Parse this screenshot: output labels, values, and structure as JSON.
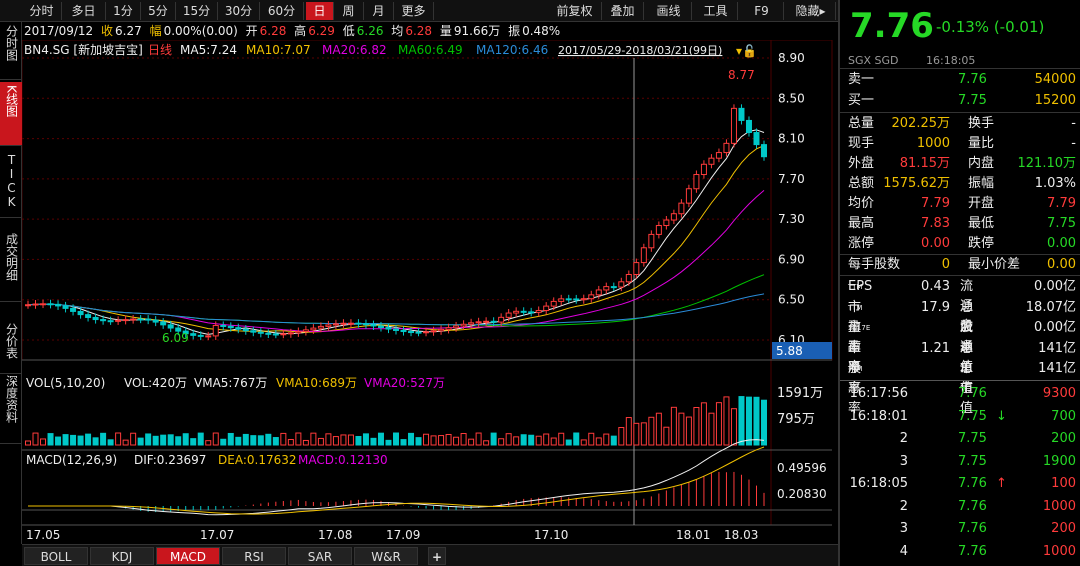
{
  "toolbar": {
    "left_buttons": [
      "分时",
      "多日",
      "1分",
      "5分",
      "15分",
      "30分",
      "60分",
      "日",
      "周",
      "月",
      "更多"
    ],
    "active": "日",
    "right_buttons": [
      "前复权",
      "叠加",
      "画线",
      "工具",
      "F9",
      "隐藏▸"
    ]
  },
  "left_tabs": [
    "分时图",
    "K线图",
    "TICK",
    "成交明细",
    "分价表",
    "深度资料"
  ],
  "left_active": "K线图",
  "ohlc_bar": {
    "date": "2017/09/12",
    "close_label": "收",
    "close": "6.27",
    "change_label": "幅",
    "change": "0.00%(0.00)",
    "open_label": "开",
    "open": "6.28",
    "high_label": "高",
    "high": "6.29",
    "low_label": "低",
    "low": "6.26",
    "avg_label": "均",
    "avg": "6.28",
    "vol_label": "量",
    "vol": "91.66万",
    "amp_label": "振",
    "amp": "0.48%"
  },
  "main_legend": {
    "code": "BN4.SG [新加坡吉宝]",
    "period": "日线",
    "ma5": "MA5:7.24",
    "ma10": "MA10:7.07",
    "ma20": "MA20:6.82",
    "ma60": "MA60:6.49",
    "ma120": "MA120:6.46",
    "range": "2017/05/29-2018/03/21(99日)"
  },
  "vol_legend": {
    "title": "VOL(5,10,20)",
    "vol": "VOL:420万",
    "vma5": "VMA5:767万",
    "vma10": "VMA10:689万",
    "vma20": "VMA20:527万"
  },
  "macd_legend": {
    "title": "MACD(12,26,9)",
    "dif": "DIF:0.23697",
    "dea": "DEA:0.17632",
    "macd": "MACD:0.12130"
  },
  "chart_data": {
    "type": "candlestick",
    "price_axis": [
      "8.90",
      "8.50",
      "8.10",
      "7.70",
      "7.30",
      "6.90",
      "6.50",
      "6.10"
    ],
    "price_ylim": [
      6.1,
      8.9
    ],
    "crosshair_price": "5.88",
    "high_marker": "8.77",
    "low_marker": "6.09",
    "vol_axis": [
      "1591万",
      "795万"
    ],
    "macd_axis": [
      "0.49596",
      "0.20830"
    ],
    "x_ticks": [
      "17.05",
      "17.07",
      "17.08",
      "17.09",
      "17.10",
      "18.01",
      "18.03"
    ],
    "colors": {
      "up": "#ff3b3b",
      "down": "#00c8c8",
      "ma5": "#f0f0f0",
      "ma10": "#f0c000",
      "ma20": "#e000e0",
      "ma60": "#00c000",
      "ma120": "#2a8bd8"
    }
  },
  "bottom_tabs": [
    "BOLL",
    "KDJ",
    "MACD",
    "RSI",
    "SAR",
    "W&R",
    "+"
  ],
  "bottom_active": "MACD",
  "quote": {
    "price": "7.76",
    "change": "-0.13% (-0.01)",
    "exchange": "SGX SGD",
    "time": "16:18:05",
    "ask_label": "卖一",
    "ask_price": "7.76",
    "ask_vol": "54000",
    "bid_label": "买一",
    "bid_price": "7.75",
    "bid_vol": "15200"
  },
  "stats": [
    {
      "l1": "总量",
      "v1": "202.25万",
      "l2": "换手",
      "v2": "-"
    },
    {
      "l1": "现手",
      "v1": "1000",
      "l2": "量比",
      "v2": "-"
    },
    {
      "l1": "外盘",
      "v1": "81.15万",
      "l2": "内盘",
      "v2": "121.10万"
    },
    {
      "l1": "总额",
      "v1": "1575.62万",
      "l2": "振幅",
      "v2": "1.03%"
    },
    {
      "l1": "均价",
      "v1": "7.79",
      "l2": "开盘",
      "v2": "7.79"
    },
    {
      "l1": "最高",
      "v1": "7.83",
      "l2": "最低",
      "v2": "7.75"
    },
    {
      "l1": "涨停",
      "v1": "0.00",
      "l2": "跌停",
      "v2": "0.00"
    }
  ],
  "lot": {
    "l1": "每手股数",
    "v1": "0",
    "l2": "最小价差",
    "v2": "0.00"
  },
  "fundamentals": [
    {
      "l1": "EPS",
      "s1": "TTM",
      "v1": "0.43",
      "l2": "流通盘",
      "s2": "",
      "v2": "0.00亿"
    },
    {
      "l1": "市盈率",
      "s1": "TTM",
      "v1": "17.9",
      "l2": "总股本",
      "s2": "",
      "v2": "18.07亿"
    },
    {
      "l1": "市盈率",
      "s1": "2017E",
      "v1": "",
      "l2": "流通值",
      "s2": "",
      "v2": "0.00亿"
    },
    {
      "l1": "市净率",
      "s1": "LF",
      "v1": "1.21",
      "l2": "总市值",
      "s2": "1",
      "v2": "141亿"
    },
    {
      "l1": "股息率",
      "s1": "TTM",
      "v1": "",
      "l2": "总市值",
      "s2": "2",
      "v2": "141亿"
    }
  ],
  "ticks": [
    {
      "time": "16:17:56",
      "price": "7.76",
      "arrow": "",
      "vol": "9300"
    },
    {
      "time": "16:18:01",
      "price": "7.75",
      "arrow": "↓",
      "vol": "700"
    },
    {
      "time": "2",
      "price": "7.75",
      "arrow": "",
      "vol": "200"
    },
    {
      "time": "3",
      "price": "7.75",
      "arrow": "",
      "vol": "1900"
    },
    {
      "time": "16:18:05",
      "price": "7.76",
      "arrow": "↑",
      "vol": "100"
    },
    {
      "time": "2",
      "price": "7.76",
      "arrow": "",
      "vol": "1000"
    },
    {
      "time": "3",
      "price": "7.76",
      "arrow": "",
      "vol": "200"
    },
    {
      "time": "4",
      "price": "7.76",
      "arrow": "",
      "vol": "1000"
    }
  ]
}
